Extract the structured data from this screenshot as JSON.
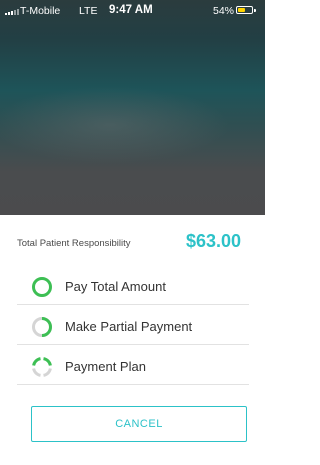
{
  "status_bar": {
    "carrier": "T-Mobile",
    "network": "LTE",
    "time": "9:47 AM",
    "battery_percent": "54%",
    "battery_level": 0.54
  },
  "payment": {
    "responsibility_label": "Total Patient Responsibility",
    "responsibility_amount": "$63.00",
    "options": [
      {
        "label": "Pay Total Amount",
        "icon": "full-circle-icon"
      },
      {
        "label": "Make Partial Payment",
        "icon": "partial-circle-icon"
      },
      {
        "label": "Payment Plan",
        "icon": "segmented-circle-icon"
      }
    ],
    "cancel_label": "CANCEL"
  },
  "colors": {
    "accent": "#2cc2c8",
    "icon_green": "#3dbf54",
    "icon_gray": "#d5d5d5"
  }
}
